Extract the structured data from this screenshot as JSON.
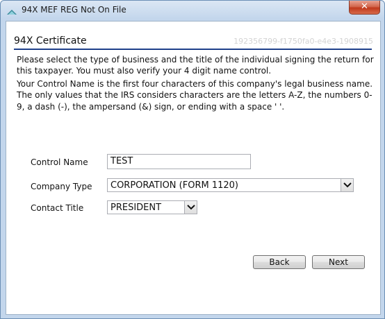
{
  "window": {
    "title": "94X MEF REG Not On File",
    "close_glyph": "✕"
  },
  "header": {
    "title": "94X Certificate",
    "watermark": "192356799-f1750fa0-e4e3-1908915"
  },
  "instructions": {
    "paragraph1": "Please select the type of business and the title of the individual signing the return for this taxpayer. You must also verify your 4 digit name control.",
    "paragraph2": "Your Control Name is the first four characters of this company's legal business name. The only values that the IRS considers characters are the letters A-Z, the numbers 0-9, a dash (-), the ampersand (&) sign, or ending with a space ' '."
  },
  "form": {
    "control_name": {
      "label": "Control Name",
      "value": "TEST"
    },
    "company_type": {
      "label": "Company Type",
      "value": "CORPORATION (FORM 1120)"
    },
    "contact_title": {
      "label": "Contact Title",
      "value": "PRESIDENT"
    }
  },
  "buttons": {
    "back": "Back",
    "next": "Next"
  },
  "colors": {
    "accent_rule": "#1e3f8a",
    "close_button": "#c0391c"
  }
}
